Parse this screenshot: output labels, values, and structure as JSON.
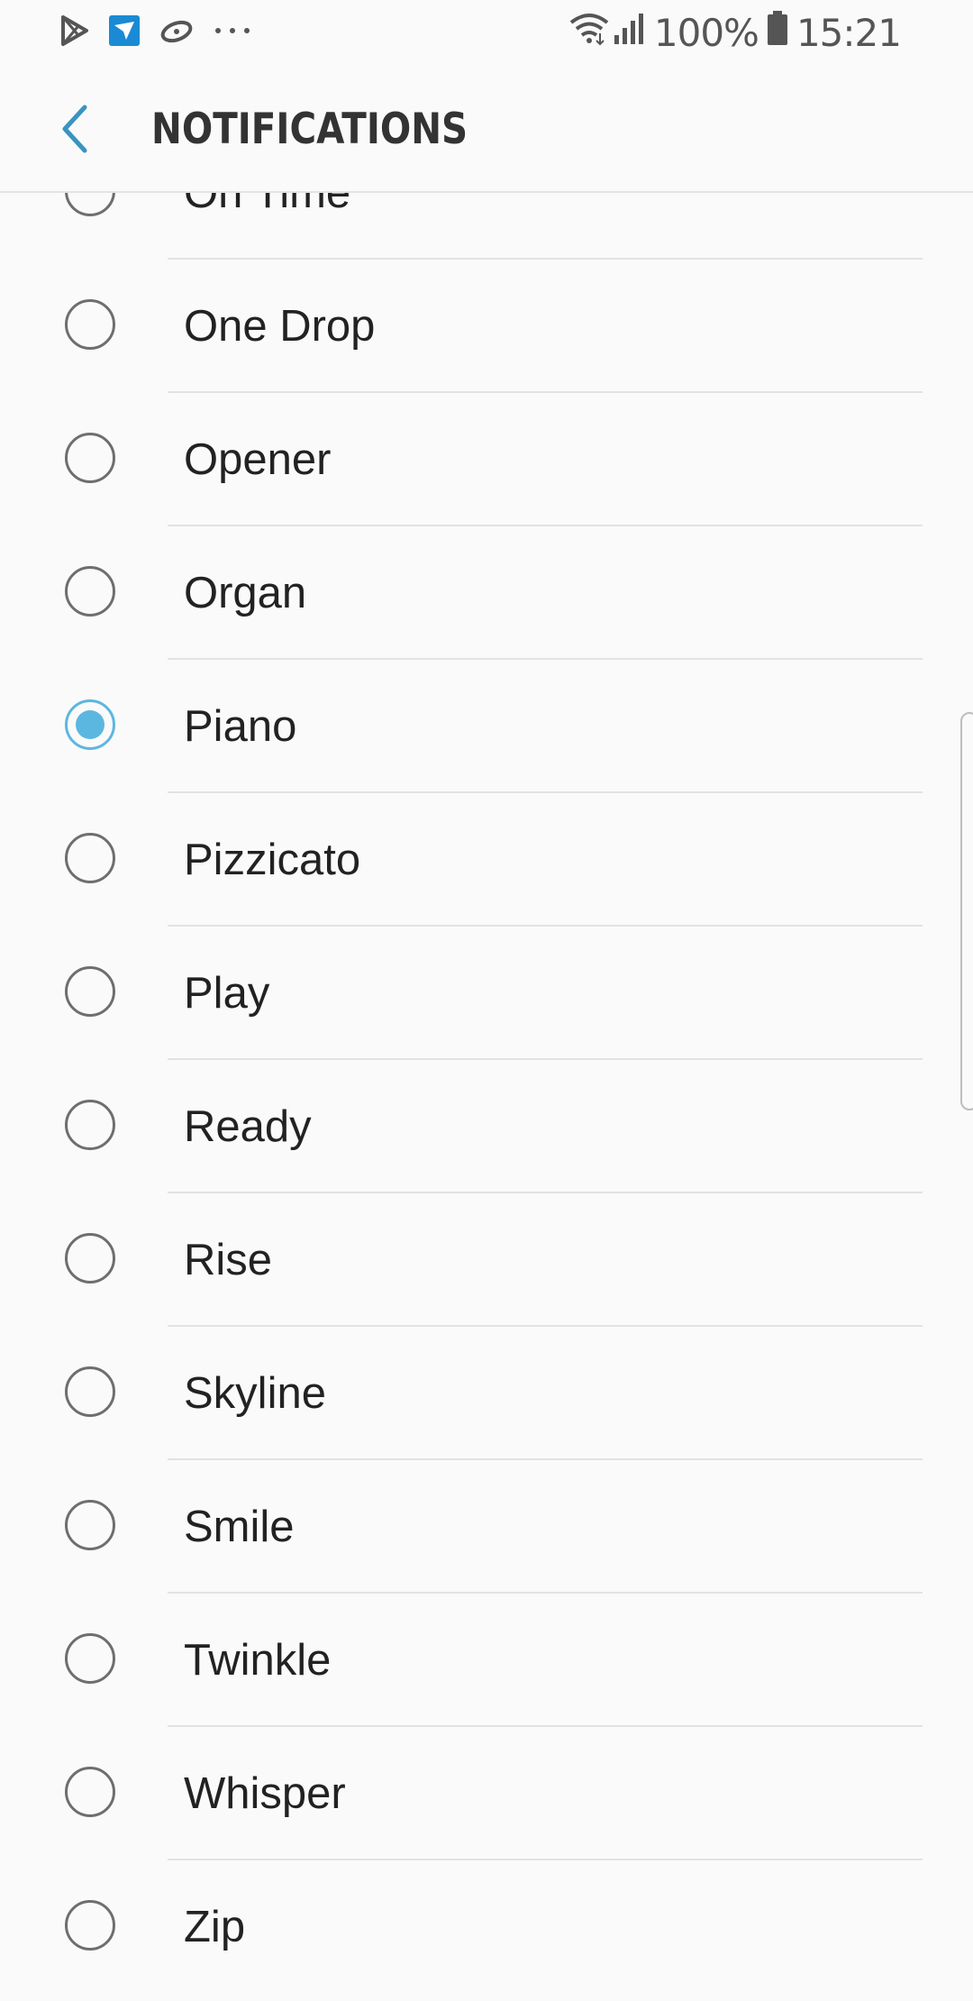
{
  "status_bar": {
    "left_icons": [
      "play-store-icon",
      "email-app-icon",
      "sync-app-icon",
      "more-dots-icon"
    ],
    "battery_percent": "100%",
    "time": "15:21",
    "right_icons": [
      "wifi-icon",
      "signal-icon",
      "battery-icon"
    ]
  },
  "header": {
    "back_icon": "chevron-left-icon",
    "title": "NOTIFICATIONS"
  },
  "sounds": {
    "selected": "Piano",
    "accent_color": "#5cb7e0",
    "items": [
      {
        "label": "On Time",
        "checked": false
      },
      {
        "label": "One Drop",
        "checked": false
      },
      {
        "label": "Opener",
        "checked": false
      },
      {
        "label": "Organ",
        "checked": false
      },
      {
        "label": "Piano",
        "checked": true
      },
      {
        "label": "Pizzicato",
        "checked": false
      },
      {
        "label": "Play",
        "checked": false
      },
      {
        "label": "Ready",
        "checked": false
      },
      {
        "label": "Rise",
        "checked": false
      },
      {
        "label": "Skyline",
        "checked": false
      },
      {
        "label": "Smile",
        "checked": false
      },
      {
        "label": "Twinkle",
        "checked": false
      },
      {
        "label": "Whisper",
        "checked": false
      },
      {
        "label": "Zip",
        "checked": false
      }
    ]
  }
}
